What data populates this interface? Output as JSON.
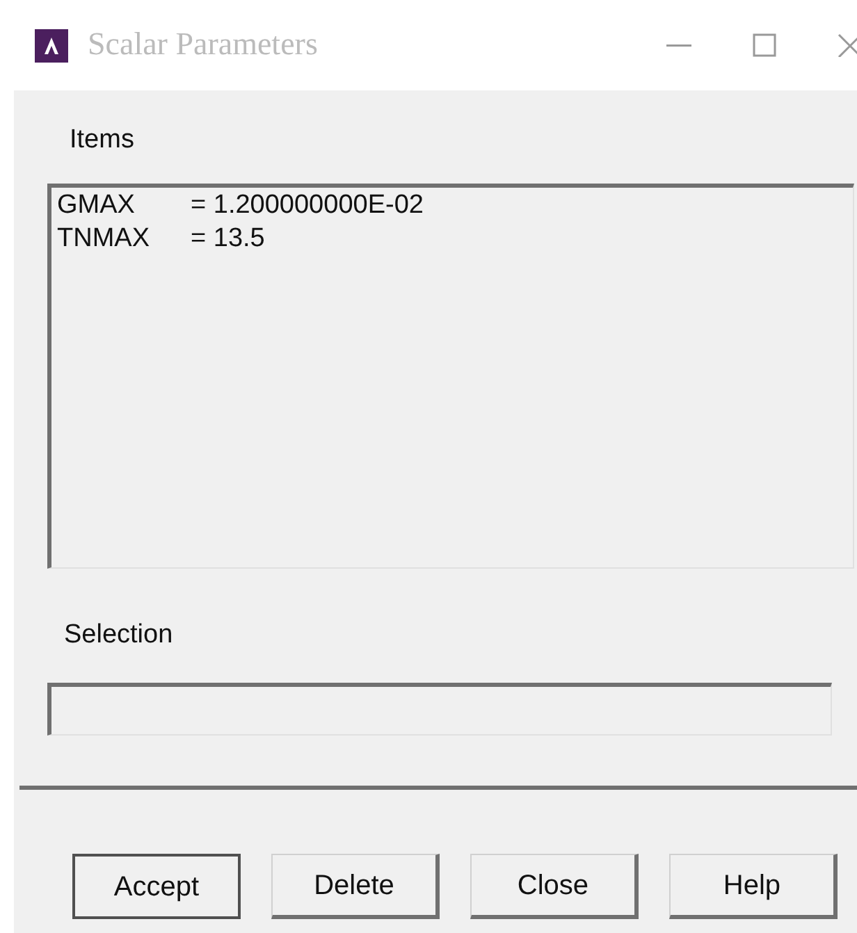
{
  "window": {
    "title": "Scalar Parameters"
  },
  "items_label": "Items",
  "items": [
    {
      "name": "GMAX",
      "value": "= 1.200000000E-02"
    },
    {
      "name": "TNMAX",
      "value": "= 13.5"
    }
  ],
  "selection": {
    "label": "Selection"
  },
  "buttons": [
    {
      "label": "Accept",
      "default": true
    },
    {
      "label": "Delete",
      "default": false
    },
    {
      "label": "Close",
      "default": false
    },
    {
      "label": "Help",
      "default": false
    }
  ]
}
